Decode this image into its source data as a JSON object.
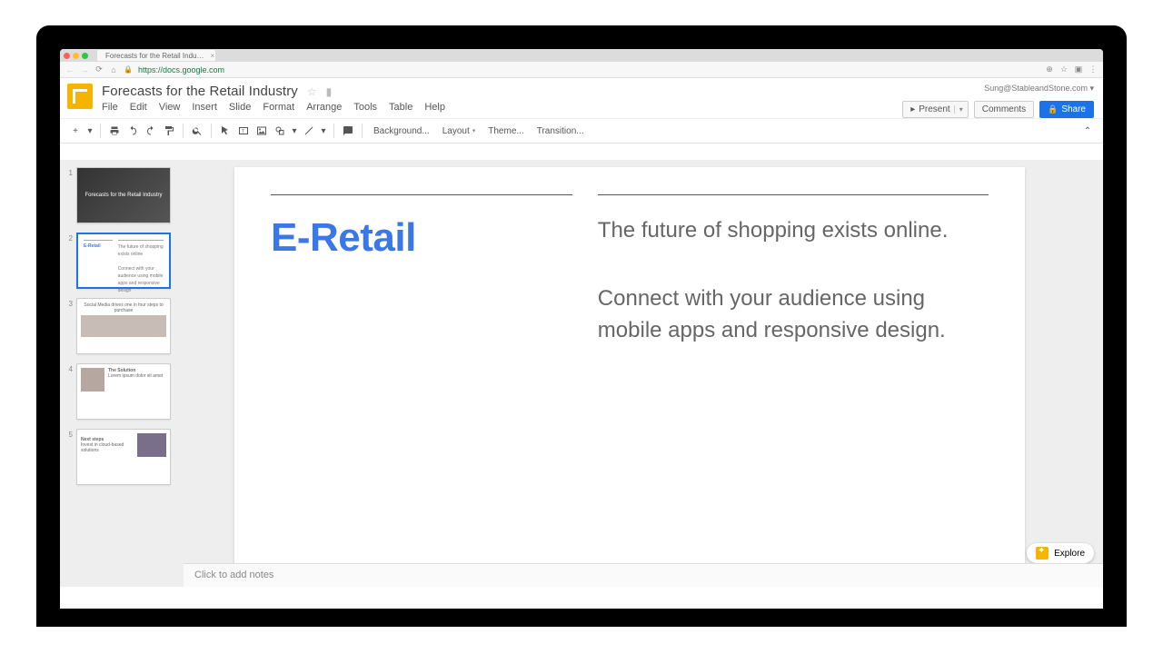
{
  "browser": {
    "tab_title": "Forecasts for the Retail Indu…",
    "url": "https://docs.google.com"
  },
  "header": {
    "doc_title": "Forecasts for the Retail Industry",
    "account": "Sung@StableandStone.com",
    "menus": [
      "File",
      "Edit",
      "View",
      "Insert",
      "Slide",
      "Format",
      "Arrange",
      "Tools",
      "Table",
      "Help"
    ],
    "buttons": {
      "present": "Present",
      "comments": "Comments",
      "share": "Share"
    }
  },
  "toolbar": {
    "background": "Background...",
    "layout": "Layout",
    "theme": "Theme...",
    "transition": "Transition..."
  },
  "slides": [
    {
      "idx": "1",
      "thumb_title": "Forecasts for the Retail Industry"
    },
    {
      "idx": "2",
      "thumb_left": "E-Retail",
      "thumb_right": "The future of shopping exists online.\nConnect with your audience using mobile apps…"
    },
    {
      "idx": "3",
      "thumb_caption": "Social Media drives one in four steps to purchase"
    },
    {
      "idx": "4",
      "thumb_heading": "The Solution"
    },
    {
      "idx": "5",
      "thumb_heading": "Next steps",
      "thumb_sub": "Invest in cloud-based solutions"
    }
  ],
  "current_slide": {
    "title": "E-Retail",
    "p1": "The future of shopping exists online.",
    "p2": "Connect with your audience using mobile apps and responsive design."
  },
  "notes_placeholder": "Click to add notes",
  "footer": {
    "explore": "Explore"
  }
}
